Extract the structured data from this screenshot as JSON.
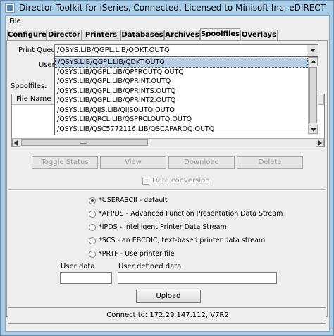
{
  "window": {
    "title": "Director Toolkit for iSeries, Connected, Licensed to Minisoft Inc, eDIRECT ..."
  },
  "menubar": {
    "file_label": "File"
  },
  "tabs": [
    {
      "label": "Configure"
    },
    {
      "label": "Director"
    },
    {
      "label": "Printers"
    },
    {
      "label": "Databases"
    },
    {
      "label": "Archives"
    },
    {
      "label": "Spoolfiles",
      "active": true
    },
    {
      "label": "Overlays"
    }
  ],
  "spoolfiles": {
    "print_queue_label": "Print Queue",
    "print_queue_value": "/QSYS.LIB/QGPL.LIB/QDKT.OUTQ",
    "user_label": "User",
    "spoolfiles_label": "Spoolfiles:",
    "dropdown_options": [
      "/QSYS.LIB/QGPL.LIB/QDKT.OUTQ",
      "/QSYS.LIB/QGPL.LIB/QPFROUTQ.OUTQ",
      "/QSYS.LIB/QGPL.LIB/QPRINT.OUTQ",
      "/QSYS.LIB/QGPL.LIB/QPRINTS.OUTQ",
      "/QSYS.LIB/QGPL.LIB/QPRINT2.OUTQ",
      "/QSYS.LIB/QIJS.LIB/QIJSOUTQ.OUTQ",
      "/QSYS.LIB/QRCL.LIB/QSPRCLOUTQ.OUTQ",
      "/QSYS.LIB/QSC5772116.LIB/QSCAPAROQ.OUTQ"
    ],
    "selected_option_index": 0,
    "table_columns": [
      "File Name"
    ],
    "buttons": {
      "toggle_status": "Toggle Status",
      "view": "View",
      "download": "Download",
      "delete": "Delete"
    },
    "data_conversion_label": "Data conversion",
    "conversion_options": [
      {
        "label": "*USERASCII - default",
        "checked": true
      },
      {
        "label": "*AFPDS - Advanced Function Presentation Data Stream",
        "checked": false
      },
      {
        "label": "*IPDS - Intelligent Printer Data Stream",
        "checked": false
      },
      {
        "label": "*SCS - an EBCDIC, text-based printer data stream",
        "checked": false
      },
      {
        "label": "*PRTF - Use printer file",
        "checked": false
      }
    ],
    "user_data_label": "User data",
    "user_data_value": "",
    "user_defined_data_label": "User defined data",
    "user_defined_data_value": "",
    "upload_label": "Upload"
  },
  "status": {
    "text": "Connect to: 172.29.147.112, V7R2"
  },
  "colors": {
    "frame": "#a8cde8",
    "client_bg": "#eeeeee",
    "selection": "#b8cfe5"
  }
}
